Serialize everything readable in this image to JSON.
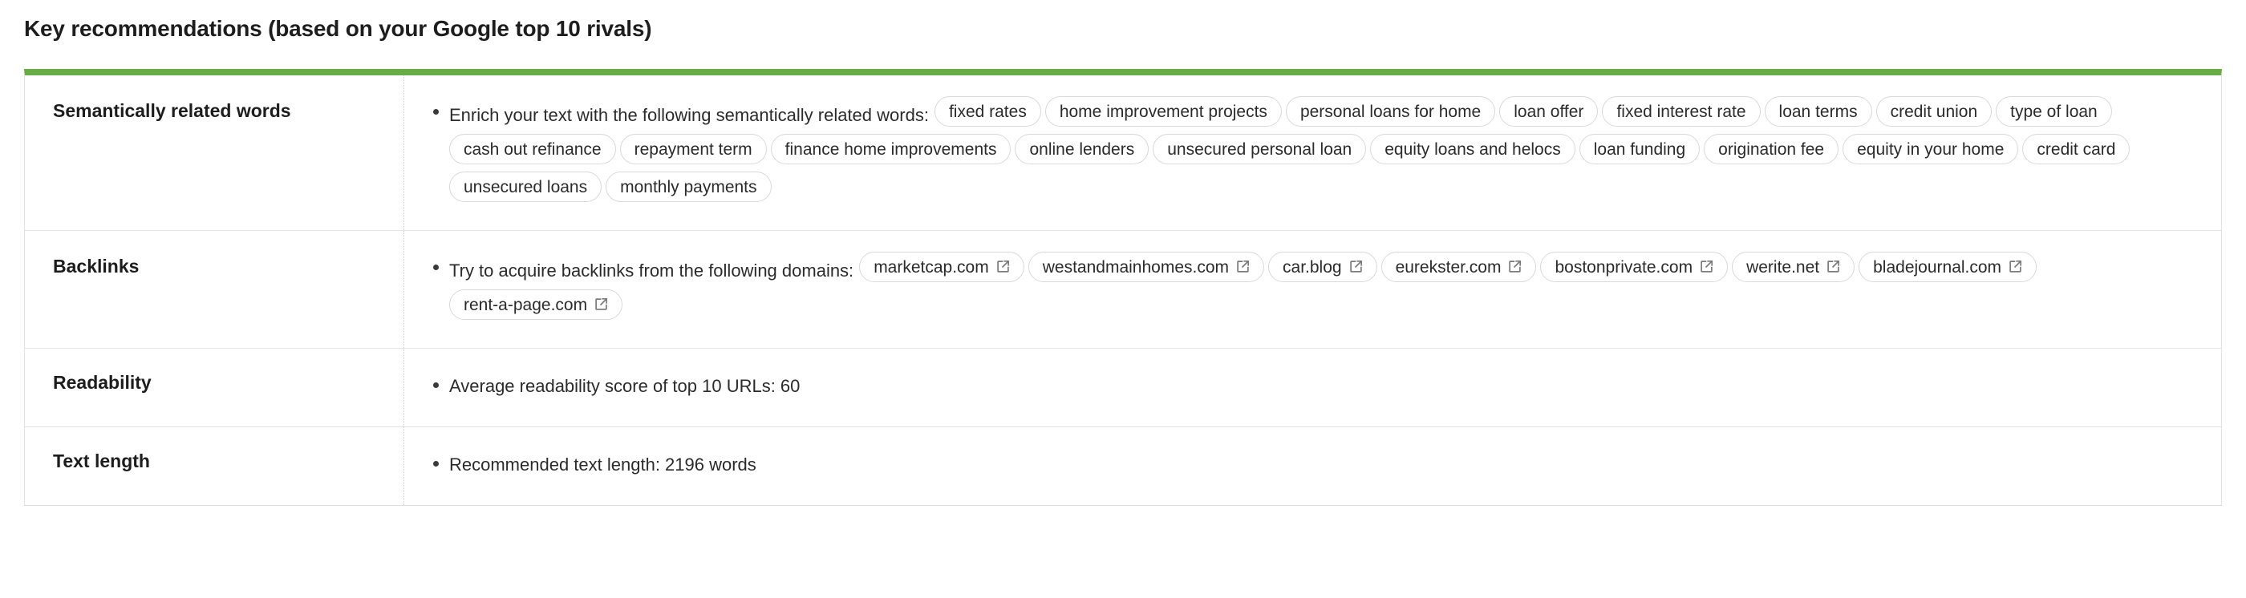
{
  "page_title": "Key recommendations (based on your Google top 10 rivals)",
  "accent_color": "#6bab46",
  "border_color": "#e2e2e2",
  "rows": {
    "semantic": {
      "label": "Semantically related words",
      "bullet_text": "Enrich your text with the following semantically related words:",
      "tags": [
        "fixed rates",
        "home improvement projects",
        "personal loans for home",
        "loan offer",
        "fixed interest rate",
        "loan terms",
        "credit union",
        "type of loan",
        "cash out refinance",
        "repayment term",
        "finance home improvements",
        "online lenders",
        "unsecured personal loan",
        "equity loans and helocs",
        "loan funding",
        "origination fee",
        "equity in your home",
        "credit card",
        "unsecured loans",
        "monthly payments"
      ]
    },
    "backlinks": {
      "label": "Backlinks",
      "bullet_text": "Try to acquire backlinks from the following domains:",
      "icon": "external-link-icon",
      "domains": [
        "marketcap.com",
        "westandmainhomes.com",
        "car.blog",
        "eurekster.com",
        "bostonprivate.com",
        "werite.net",
        "bladejournal.com",
        "rent-a-page.com"
      ]
    },
    "readability": {
      "label": "Readability",
      "bullet_text": "Average readability score of top 10 URLs:  60"
    },
    "text_length": {
      "label": "Text length",
      "bullet_text": "Recommended text length:  2196 words"
    }
  }
}
